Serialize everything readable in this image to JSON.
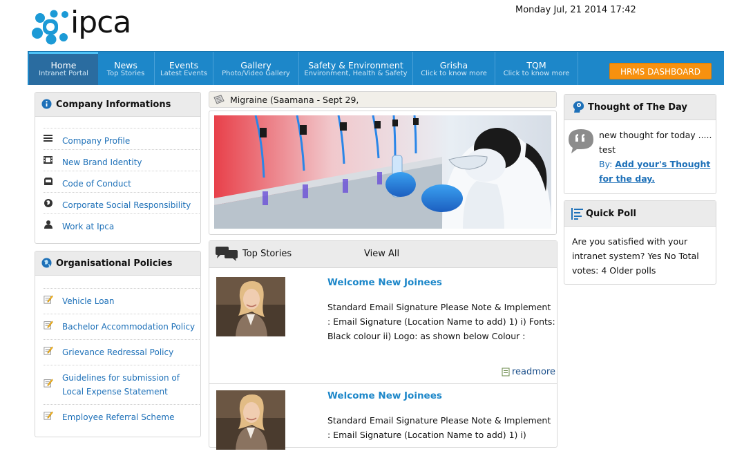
{
  "header": {
    "brand": "ipca",
    "datetime": "Monday Jul, 21 2014 17:42"
  },
  "nav": {
    "items": [
      {
        "title": "Home",
        "subtitle": "Intranet Portal"
      },
      {
        "title": "News",
        "subtitle": "Top Stories"
      },
      {
        "title": "Events",
        "subtitle": "Latest Events"
      },
      {
        "title": "Gallery",
        "subtitle": "Photo/Video Gallery"
      },
      {
        "title": "Safety & Environment",
        "subtitle": "Environment, Health & Safety"
      },
      {
        "title": "Grisha",
        "subtitle": "Click to know more"
      },
      {
        "title": "TQM",
        "subtitle": "Click to know more"
      }
    ],
    "hrms_label": "HRMS DASHBOARD"
  },
  "company": {
    "title": "Company Informations",
    "links": [
      {
        "label": "Company Profile",
        "icon": "list-icon"
      },
      {
        "label": "New Brand Identity",
        "icon": "film-icon"
      },
      {
        "label": "Code of Conduct",
        "icon": "inbox-icon"
      },
      {
        "label": "Corporate Social Responsibility",
        "icon": "globe-icon"
      },
      {
        "label": "Work at Ipca",
        "icon": "user-icon"
      }
    ]
  },
  "policies": {
    "title": "Organisational Policies",
    "links": [
      {
        "label": "Vehicle Loan"
      },
      {
        "label": "Bachelor Accommodation Policy"
      },
      {
        "label": "Grievance Redressal Policy"
      },
      {
        "label": "Guidelines for submission of Local Expense Statement"
      },
      {
        "label": "Employee Referral Scheme"
      }
    ]
  },
  "ticker": {
    "text": "Migraine (Saamana - Sept 29,"
  },
  "stories": {
    "title": "Top Stories",
    "view_all": "View All",
    "items": [
      {
        "title": "Welcome New Joinees",
        "body": "Standard Email Signature Please Note & Implement : Email Signature (Location Name to add) 1) i) Fonts: Black colour ii) Logo: as shown below Colour :",
        "readmore": "readmore"
      },
      {
        "title": "Welcome New Joinees",
        "body": "Standard Email Signature Please Note & Implement : Email Signature (Location Name to add) 1) i)"
      }
    ]
  },
  "thought": {
    "title": "Thought of The Day",
    "text": "new thought for today ..... test",
    "by_label": "By:",
    "link": "Add your's Thought for the day."
  },
  "poll": {
    "title": "Quick Poll",
    "text": "Are you satisfied with your intranet system? Yes No Total votes: 4 Older polls"
  },
  "colors": {
    "nav_blue": "#1d87c9",
    "hrms_orange": "#f7910f",
    "link_blue": "#1d70b8",
    "title_blue": "#1d87c9"
  }
}
